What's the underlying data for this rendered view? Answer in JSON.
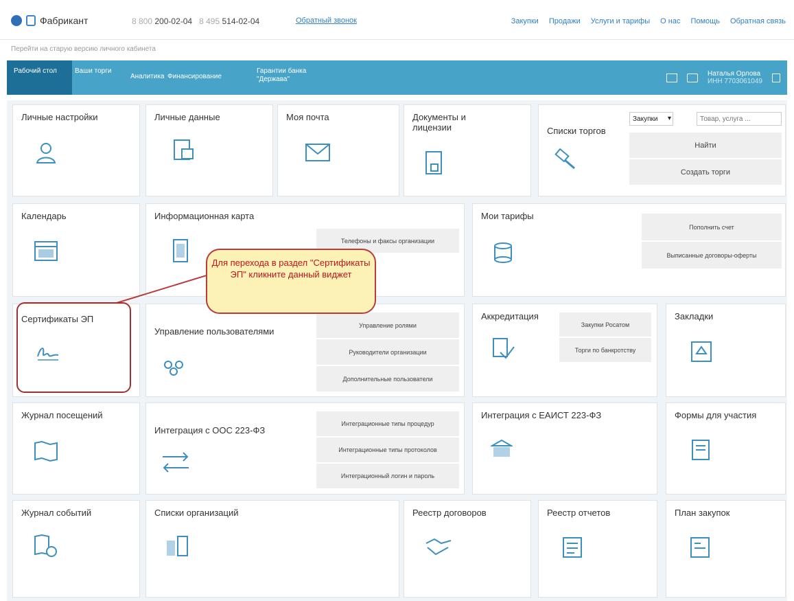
{
  "header": {
    "brand": "Фабрикант",
    "phone1_prefix": "8 800",
    "phone1": "200-02-04",
    "phone2_prefix": "8 495",
    "phone2": "514-02-04",
    "callback": "Обратный звонок",
    "nav": [
      "Закупки",
      "Продажи",
      "Услуги и тарифы",
      "О нас",
      "Помощь",
      "Обратная связь"
    ],
    "old_version": "Перейти на старую версию личного кабинета"
  },
  "bluenav": {
    "items": [
      "Рабочий стол",
      "Ваши торги",
      "Аналитика",
      "Финансирование",
      "Гарантии банка \"Держава\""
    ],
    "user_name": "Наталья Орлова",
    "user_inn": "ИНН 7703061049"
  },
  "tiles": {
    "personal_settings": "Личные настройки",
    "personal_data": "Личные данные",
    "my_mail": "Моя почта",
    "docs": "Документы и лицензии",
    "tender_lists": "Списки торгов",
    "search_select": "Закупки",
    "search_placeholder": "Товар, услуга ...",
    "find": "Найти",
    "create": "Создать торги",
    "calendar": "Календарь",
    "info_card": "Информационная карта",
    "phones_faxes": "Телефоны и факсы организации",
    "my_tariffs": "Мои тарифы",
    "top_up": "Пополнить счет",
    "offers": "Выписанные договоры-оферты",
    "certs": "Сертификаты ЭП",
    "user_mgmt": "Управление пользователями",
    "roles": "Управление ролями",
    "heads": "Руководители организации",
    "extra_users": "Дополнительные пользователи",
    "accreditation": "Аккредитация",
    "rosatom": "Закупки Росатом",
    "bankruptcy": "Торги по банкротству",
    "bookmarks": "Закладки",
    "visits": "Журнал посещений",
    "oos": "Интеграция с ООС 223-ФЗ",
    "proc_types": "Интеграционные типы процедур",
    "prot_types": "Интеграционные типы протоколов",
    "login_pass": "Интеграционный логин и пароль",
    "eaist": "Интеграция с ЕАИСТ 223-ФЗ",
    "forms": "Формы для участия",
    "events": "Журнал событий",
    "orgs": "Списки организаций",
    "contracts": "Реестр договоров",
    "reports": "Реестр отчетов",
    "plan": "План закупок"
  },
  "callout": "Для перехода в раздел \"Сертификаты ЭП\" кликните данный виджет"
}
